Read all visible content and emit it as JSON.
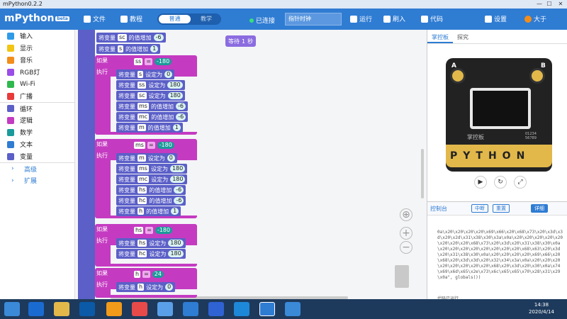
{
  "window": {
    "title": "mPython0.2.2"
  },
  "app": {
    "logo": "mPython",
    "logo_badge": "beta"
  },
  "menu": {
    "file": "文件",
    "tutorial": "教程",
    "mode_normal": "普通",
    "mode_teach": "教学",
    "connected": "已连接",
    "filename": "指针时钟",
    "run": "运行",
    "flash": "刷入",
    "code": "代码",
    "settings": "设置",
    "user": "大于"
  },
  "categories": [
    {
      "label": "输入",
      "color": "#2f9be8"
    },
    {
      "label": "显示",
      "color": "#f2c514"
    },
    {
      "label": "音乐",
      "color": "#f28d1a"
    },
    {
      "label": "RGB灯",
      "color": "#9a4de8"
    },
    {
      "label": "Wi-Fi",
      "color": "#2fb84d"
    },
    {
      "label": "广播",
      "color": "#e83a3a"
    },
    {
      "label": "循环",
      "color": "#5b5fc7"
    },
    {
      "label": "逻辑",
      "color": "#c43bc1"
    },
    {
      "label": "数学",
      "color": "#1a9a9a"
    },
    {
      "label": "文本",
      "color": "#2f7cd3"
    },
    {
      "label": "变量",
      "color": "#5b5fc7"
    },
    {
      "label": "高级",
      "color": ""
    },
    {
      "label": "扩展",
      "color": ""
    }
  ],
  "blocks": {
    "set_var": "将变量",
    "inc": "的值增加",
    "set_to": "设定为",
    "if": "如果",
    "do": "执行",
    "eq": "=",
    "top1": {
      "var": "sc",
      "val": "-6"
    },
    "top2": {
      "var": "s",
      "val": "1"
    },
    "wait": {
      "label": "等待",
      "val": "1",
      "unit": "秒"
    },
    "if1": {
      "var": "ss",
      "val": "-180"
    },
    "if1_body": [
      {
        "var": "s",
        "op": "设定为",
        "val": "0"
      },
      {
        "var": "ss",
        "op": "设定为",
        "val": "180"
      },
      {
        "var": "sc",
        "op": "设定为",
        "val": "180"
      },
      {
        "var": "ms",
        "op": "的值增加",
        "val": "-6"
      },
      {
        "var": "mc",
        "op": "的值增加",
        "val": "-6"
      },
      {
        "var": "m",
        "op": "的值增加",
        "val": "1"
      }
    ],
    "if2": {
      "var": "ms",
      "val": "-180"
    },
    "if2_body": [
      {
        "var": "m",
        "op": "设定为",
        "val": "0"
      },
      {
        "var": "ms",
        "op": "设定为",
        "val": "180"
      },
      {
        "var": "mc",
        "op": "设定为",
        "val": "180"
      },
      {
        "var": "hs",
        "op": "的值增加",
        "val": "-6"
      },
      {
        "var": "hc",
        "op": "的值增加",
        "val": "-6"
      },
      {
        "var": "h",
        "op": "的值增加",
        "val": "1"
      }
    ],
    "if3": {
      "var": "hs",
      "val": "-180"
    },
    "if3_body": [
      {
        "var": "hs",
        "op": "设定为",
        "val": "180"
      },
      {
        "var": "hc",
        "op": "设定为",
        "val": "180"
      }
    ],
    "if4": {
      "var": "h",
      "val": "24"
    },
    "if4_body": [
      {
        "var": "h",
        "op": "设定为",
        "val": "0"
      }
    ]
  },
  "panel": {
    "tab_board": "掌控板",
    "tab_explore": "探究",
    "board_a": "A",
    "board_b": "B",
    "board_name": "掌控板",
    "board_id": "01234\n56789",
    "board_pins": "PYTHON",
    "console_title": "控制台",
    "btn_hex": "中断",
    "btn_reset": "重置",
    "btn_detail": "详细",
    "console_text": "0a\\x20\\x20\\x20\\x20\\x69\\x66\\x20\\x68\\x73\\x20\\x3d\\x3d\\x20\\x2d\\x31\\x38\\x30\\x3a\\x0a\\x20\\x20\\x20\\x20\\x20\\x20\\x20\\x20\\x68\\x73\\x20\\x3d\\x20\\x31\\x38\\x30\\x0a\\x20\\x20\\x20\\x20\\x20\\x20\\x20\\x20\\x68\\x63\\x20\\x3d\\x20\\x31\\x38\\x30\\x0a\\x20\\x20\\x20\\x20\\x69\\x66\\x20\\x68\\x20\\x3d\\x3d\\x20\\x32\\x34\\x3a\\x0a\\x20\\x20\\x20\\x20\\x20\\x20\\x20\\x20\\x68\\x20\\x3d\\x20\\x30\\x0a\\x74\\x69\\x6d\\x65\\x2e\\x73\\x6c\\x65\\x65\\x70\\x28\\x31\\x29\\x0a\", globals())",
    "console_status": "代码已运行"
  },
  "taskbar": {
    "time": "14:38",
    "date": "2020/4/14"
  }
}
